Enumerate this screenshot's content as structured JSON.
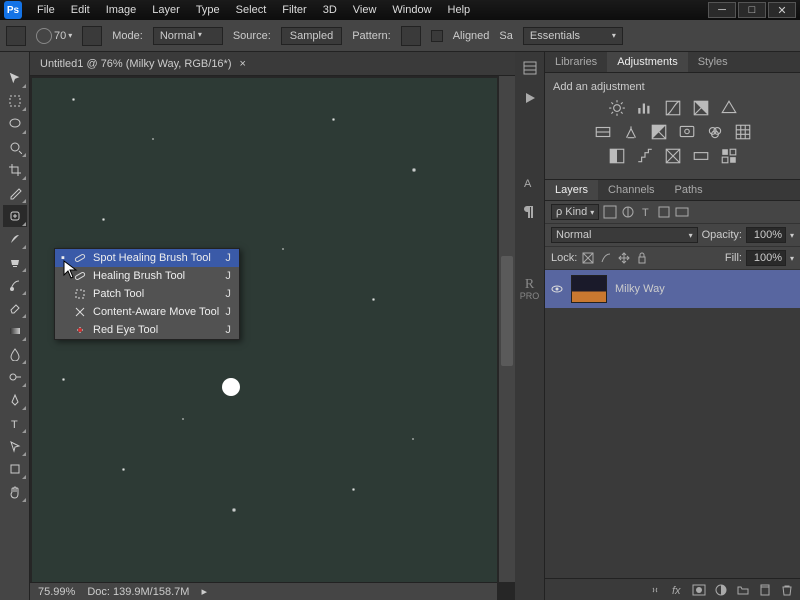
{
  "app": {
    "logo": "Ps"
  },
  "menu": [
    "File",
    "Edit",
    "Image",
    "Layer",
    "Type",
    "Select",
    "Filter",
    "3D",
    "View",
    "Window",
    "Help"
  ],
  "optbar": {
    "size": "70",
    "mode_label": "Mode:",
    "mode_value": "Normal",
    "source_label": "Source:",
    "sampled": "Sampled",
    "pattern": "Pattern:",
    "aligned": "Aligned",
    "sample_prefix": "Sa",
    "workspace": "Essentials"
  },
  "doc": {
    "tab_title": "Untitled1 @ 76% (Milky Way, RGB/16*)",
    "close": "×",
    "zoom": "75.99%",
    "docinfo": "Doc: 139.9M/158.7M"
  },
  "flyout": {
    "items": [
      {
        "label": "Spot Healing Brush Tool",
        "key": "J"
      },
      {
        "label": "Healing Brush Tool",
        "key": "J"
      },
      {
        "label": "Patch Tool",
        "key": "J"
      },
      {
        "label": "Content-Aware Move Tool",
        "key": "J"
      },
      {
        "label": "Red Eye Tool",
        "key": "J"
      }
    ]
  },
  "rpanel": {
    "tabs_top": [
      "Libraries",
      "Adjustments",
      "Styles"
    ],
    "adj_title": "Add an adjustment",
    "tabs_layers": [
      "Layers",
      "Channels",
      "Paths"
    ],
    "kind": "Kind",
    "blend": "Normal",
    "opacity_lbl": "Opacity:",
    "opacity": "100%",
    "lock_lbl": "Lock:",
    "fill_lbl": "Fill:",
    "fill": "100%",
    "layer_name": "Milky Way"
  },
  "mid": {
    "rpro": "R"
  }
}
